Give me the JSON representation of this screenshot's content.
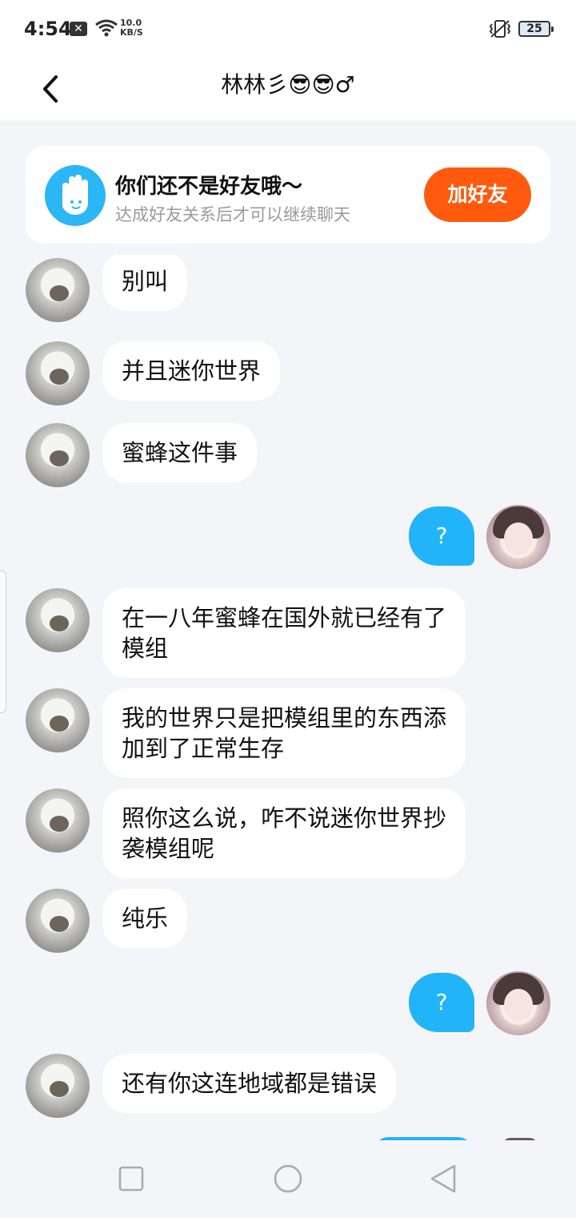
{
  "status_bar": {
    "time": "4:54",
    "speed_value": "10.0",
    "speed_unit": "KB/S",
    "battery": "25",
    "icons": [
      "close-notification-icon",
      "wifi-icon",
      "vibrate-icon",
      "battery-icon"
    ]
  },
  "header": {
    "title": "林林彡😎😎♂"
  },
  "banner": {
    "title": "你们还不是好友哦～",
    "subtitle": "达成好友关系后才可以继续聊天",
    "button_label": "加好友",
    "button_color": "#ff5a0e",
    "icon": "hand-wave-icon"
  },
  "messages": [
    {
      "side": "left",
      "text": "别叫"
    },
    {
      "side": "left",
      "text": "并且迷你世界"
    },
    {
      "side": "left",
      "text": "蜜蜂这件事"
    },
    {
      "side": "right",
      "text": "?"
    },
    {
      "side": "left",
      "text": "在一八年蜜蜂在国外就已经有了\n模组"
    },
    {
      "side": "left",
      "text": "我的世界只是把模组里的东西添\n加到了正常生存"
    },
    {
      "side": "left",
      "text": "照你这么说，咋不说迷你世界抄\n袭模组呢"
    },
    {
      "side": "left",
      "text": "纯乐"
    },
    {
      "side": "right",
      "text": "?"
    },
    {
      "side": "left",
      "text": "还有你这连地域都是错误"
    }
  ],
  "colors": {
    "accent_blue": "#22b4f8",
    "background": "#f4f5f8"
  },
  "nav": {
    "icons": [
      "recent-apps-icon",
      "home-icon",
      "back-nav-icon"
    ]
  }
}
